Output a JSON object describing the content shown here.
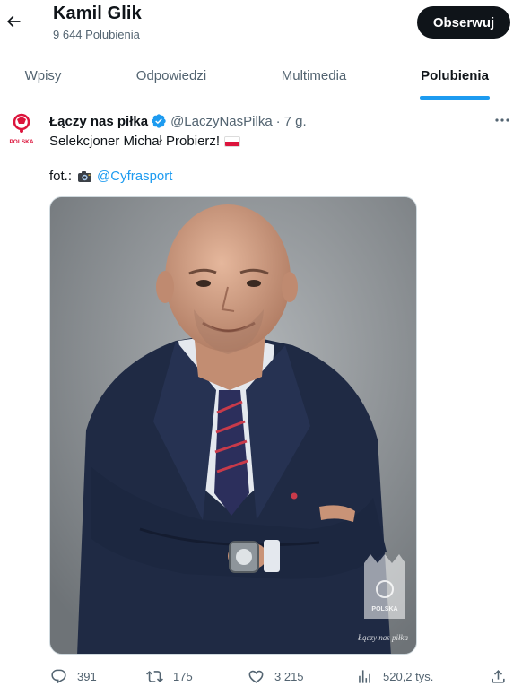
{
  "header": {
    "back_icon": "arrow-left-icon",
    "title": "Kamil Glik",
    "subtitle": "9 644 Polubienia",
    "follow_label": "Obserwuj"
  },
  "tabs": [
    {
      "label": "Wpisy",
      "active": false
    },
    {
      "label": "Odpowiedzi",
      "active": false
    },
    {
      "label": "Multimedia",
      "active": false
    },
    {
      "label": "Polubienia",
      "active": true
    }
  ],
  "post": {
    "author": "Łączy nas piłka",
    "verified_icon": "verified-badge-icon",
    "handle": "@LaczyNasPilka",
    "separator": "·",
    "time": "7 g.",
    "text": "Selekcjoner Michał Probierz!",
    "credit_prefix": "fot.:",
    "credit_link": "@Cyfrasport",
    "avatar_text": "POLSKA",
    "photo_watermark": "POLSKA",
    "photo_signature": "Łączy nas piłka"
  },
  "actions": [
    {
      "icon": "reply-icon",
      "count": "391"
    },
    {
      "icon": "repost-icon",
      "count": "175"
    },
    {
      "icon": "like-icon",
      "count": "3 215"
    },
    {
      "icon": "views-icon",
      "count": "520,2 tys."
    },
    {
      "icon": "share-icon",
      "count": ""
    }
  ],
  "colors": {
    "accent": "#1d9bf0",
    "text_primary": "#0f1419",
    "text_secondary": "#536471",
    "follow_bg": "#0f1419",
    "flag_red": "#dc143c"
  }
}
